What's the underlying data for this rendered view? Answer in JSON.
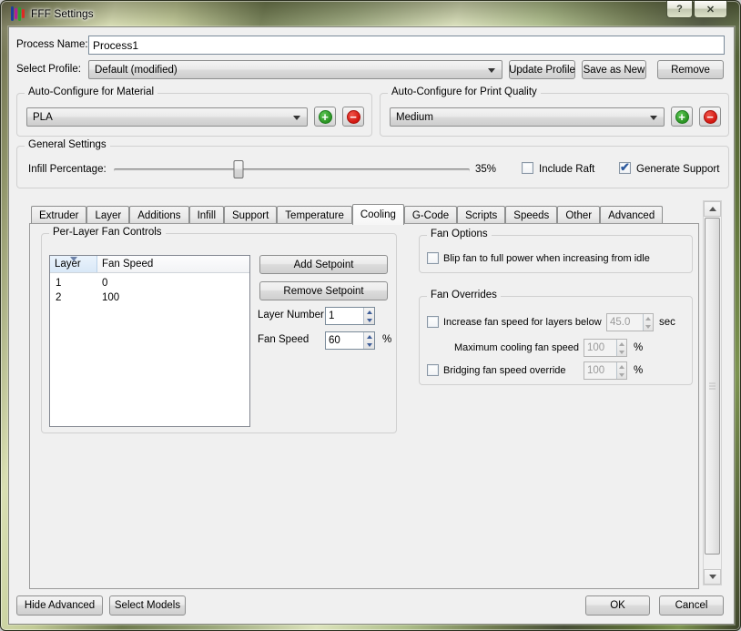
{
  "window": {
    "title": "FFF Settings",
    "help_glyph": "?",
    "close_glyph": "✕"
  },
  "header": {
    "process_label": "Process Name:",
    "process_value": "Process1",
    "profile_label": "Select Profile:",
    "profile_value": "Default (modified)",
    "update_button": "Update Profile",
    "save_button": "Save as New",
    "remove_button": "Remove"
  },
  "auto_configure": {
    "material": {
      "title": "Auto-Configure for Material",
      "value": "PLA"
    },
    "quality": {
      "title": "Auto-Configure for Print Quality",
      "value": "Medium"
    }
  },
  "general": {
    "title": "General Settings",
    "infill_label": "Infill Percentage:",
    "infill_percent": 35,
    "infill_text": "35%",
    "raft": {
      "label": "Include Raft",
      "checked": false
    },
    "support": {
      "label": "Generate Support",
      "checked": true
    }
  },
  "tabs": [
    "Extruder",
    "Layer",
    "Additions",
    "Infill",
    "Support",
    "Temperature",
    "Cooling",
    "G-Code",
    "Scripts",
    "Speeds",
    "Other",
    "Advanced"
  ],
  "active_tab": "Cooling",
  "cooling": {
    "per_layer": {
      "title": "Per-Layer Fan Controls",
      "columns": [
        "Layer",
        "Fan Speed"
      ],
      "rows": [
        [
          "1",
          "0"
        ],
        [
          "2",
          "100"
        ]
      ],
      "add_button": "Add Setpoint",
      "remove_button": "Remove Setpoint",
      "layer_number": {
        "label": "Layer Number",
        "value": "1"
      },
      "fan_speed": {
        "label": "Fan Speed",
        "value": "60",
        "unit": "%"
      }
    },
    "fan_options": {
      "title": "Fan Options",
      "blip": {
        "label": "Blip fan to full power when increasing from idle",
        "checked": false
      }
    },
    "fan_overrides": {
      "title": "Fan Overrides",
      "increase": {
        "label": "Increase fan speed for layers below",
        "checked": false,
        "value": "45.0",
        "unit": "sec"
      },
      "max_cooling": {
        "label": "Maximum cooling fan speed",
        "value": "100",
        "unit": "%"
      },
      "bridging": {
        "label": "Bridging fan speed override",
        "checked": false,
        "value": "100",
        "unit": "%"
      }
    }
  },
  "footer": {
    "hide_advanced": "Hide Advanced",
    "select_models": "Select Models",
    "ok": "OK",
    "cancel": "Cancel"
  },
  "colors": {
    "add_green": "#2ca02c",
    "remove_red": "#e02020",
    "check_blue": "#2d5a9e",
    "client_bg": "#f0f0f0"
  }
}
